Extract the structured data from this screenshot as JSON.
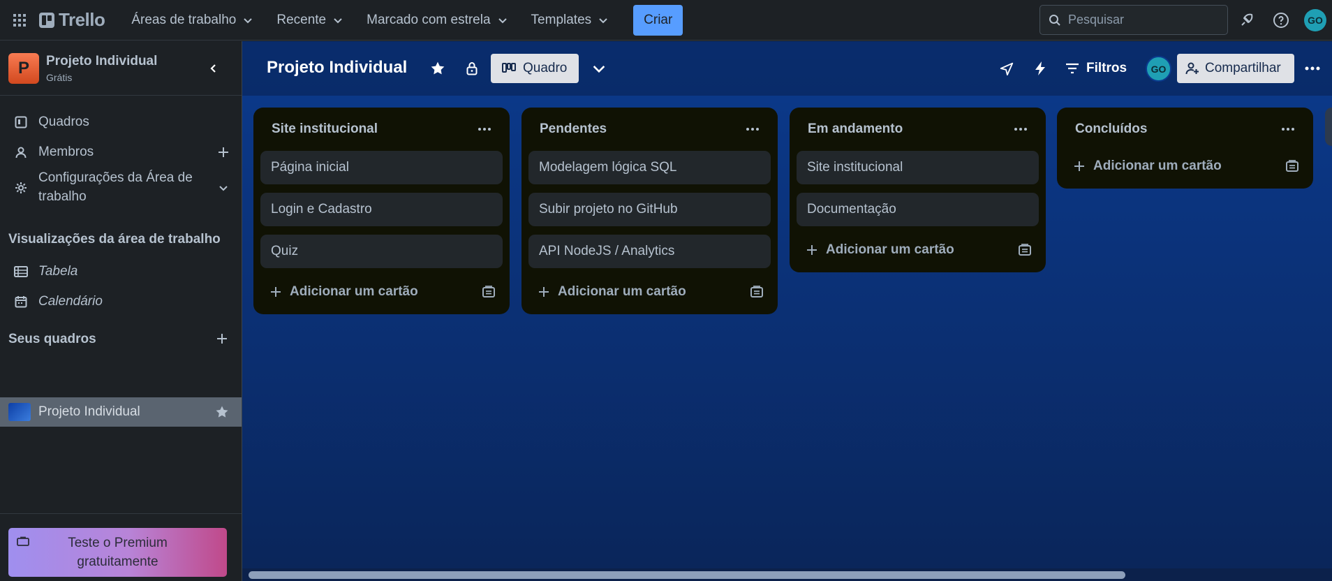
{
  "topbar": {
    "logo": "Trello",
    "nav": [
      "Áreas de trabalho",
      "Recente",
      "Marcado com estrela",
      "Templates"
    ],
    "create": "Criar",
    "search_placeholder": "Pesquisar",
    "avatar": "GO"
  },
  "sidebar": {
    "workspace_initial": "P",
    "workspace_name": "Projeto Individual",
    "workspace_plan": "Grátis",
    "items": {
      "boards": "Quadros",
      "members": "Membros",
      "settings": "Configurações da Área de trabalho"
    },
    "views_title": "Visualizações da área de trabalho",
    "views": [
      "Tabela",
      "Calendário"
    ],
    "your_boards_title": "Seus quadros",
    "board_name": "Projeto Individual",
    "premium": "Teste o Premium gratuitamente"
  },
  "board": {
    "title": "Projeto Individual",
    "view": "Quadro",
    "filters": "Filtros",
    "member_avatar": "GO",
    "share": "Compartilhar",
    "add_card": "Adicionar um cartão",
    "lists": [
      {
        "title": "Site institucional",
        "cards": [
          "Página inicial",
          "Login e Cadastro",
          "Quiz"
        ]
      },
      {
        "title": "Pendentes",
        "cards": [
          "Modelagem lógica SQL",
          "Subir projeto no GitHub",
          "API NodeJS / Analytics"
        ]
      },
      {
        "title": "Em andamento",
        "cards": [
          "Site institucional",
          "Documentação"
        ]
      },
      {
        "title": "Concluídos",
        "cards": []
      }
    ]
  },
  "colors": {
    "accent": "#579dff",
    "board_bg": "#0b3a8d",
    "list_bg": "#101204",
    "card_bg": "#22272b"
  }
}
